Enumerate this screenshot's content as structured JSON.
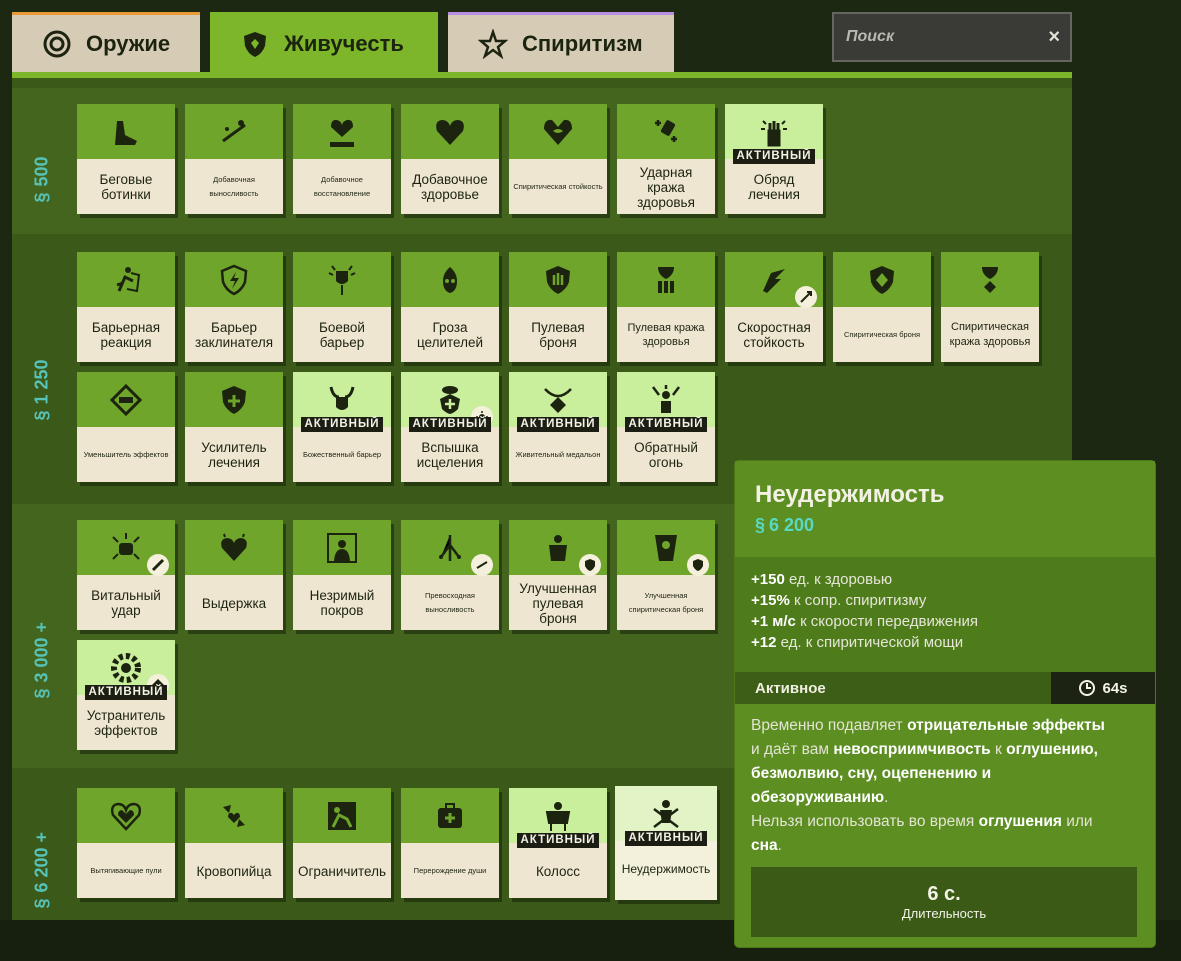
{
  "tabs": [
    {
      "label": "Оружие",
      "icon": "weapon-icon"
    },
    {
      "label": "Живучесть",
      "icon": "vitality-icon"
    },
    {
      "label": "Спиритизм",
      "icon": "spirit-icon"
    }
  ],
  "search": {
    "placeholder": "Поиск",
    "clear": "×"
  },
  "tiers": [
    {
      "cost": "500"
    },
    {
      "cost": "1 250"
    },
    {
      "cost": "3 000 +"
    },
    {
      "cost": "6 200 +"
    }
  ],
  "items": {
    "t1": [
      "Беговые ботинки",
      "Добавочная выносливость",
      "Добавочное восстановление",
      "Добавочное здоровье",
      "Спиритическая стойкость",
      "Ударная кража здоровья",
      "Обряд лечения"
    ],
    "t2": [
      "Барьерная реакция",
      "Барьер заклинателя",
      "Боевой барьер",
      "Гроза целителей",
      "Пулевая броня",
      "Пулевая кража здоровья",
      "Скоростная стойкость",
      "Спиритическая броня",
      "Спиритическая кража здоровья",
      "Уменьшитель эффектов",
      "Усилитель лечения",
      "Божественный барьер",
      "Вспышка исцеления",
      "Живительный медальон",
      "Обратный огонь"
    ],
    "t3": [
      "Витальный удар",
      "Выдержка",
      "Незримый покров",
      "Превосходная выносливость",
      "Улучшенная пулевая броня",
      "Улучшенная спиритическая броня",
      "Устранитель эффектов"
    ],
    "t4": [
      "Вытягивающие пули",
      "Кровопийца",
      "Ограничитель",
      "Перерождение души",
      "Колосс",
      "Неудержимость"
    ]
  },
  "badge": "АКТИВНЫЙ",
  "tooltip": {
    "title": "Неудержимость",
    "cost": "6 200",
    "stats": [
      {
        "value": "+150",
        "unit": "",
        "text": "ед. к здоровью"
      },
      {
        "value": "+15",
        "unit": "%",
        "text": "к сопр. спиритизму"
      },
      {
        "value": "+1",
        "unit": "м/с",
        "text": "к скорости передвижения"
      },
      {
        "value": "+12",
        "unit": "",
        "text": "ед. к спиритической мощи"
      }
    ],
    "active_label": "Активное",
    "cooldown": "64s",
    "desc": {
      "p1a": "Временно подавляет ",
      "p1b": "отрицательные эффекты",
      "p2a": "и даёт вам ",
      "p2b": "невосприимчивость",
      "p2c": " к ",
      "p2d": "оглушению,",
      "p3": "безмолвию, сну, оцепенению и",
      "p4": "обезоруживанию",
      "p4end": ".",
      "p5a": "Нельзя использовать во время ",
      "p5b": "оглушения",
      "p5c": " или",
      "p6": "сна",
      "p6end": "."
    },
    "duration_value": "6 с.",
    "duration_label": "Длительность"
  },
  "colors": {
    "accent": "#7db62a",
    "card_top": "#6ea52a",
    "card_active": "#c9ee9c",
    "cost": "#57c3b8"
  }
}
